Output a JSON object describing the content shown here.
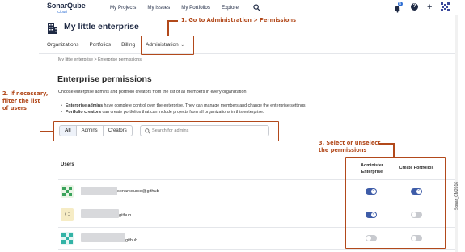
{
  "topnav": {
    "logo_name": "SonarQube",
    "logo_sub": "Cloud",
    "links": [
      "My Projects",
      "My Issues",
      "My Portfolios",
      "Explore"
    ],
    "notification_count": "5",
    "help_label": "?",
    "plus_label": "+"
  },
  "org": {
    "title": "My little enterprise",
    "tabs": [
      "Organizations",
      "Portfolios",
      "Billing",
      "Administration"
    ]
  },
  "breadcrumb": "My little enterprise > Enterprise permissions",
  "page": {
    "title": "Enterprise permissions",
    "intro": "Choose enterprise admins and portfolio creators from the list of all members in every organization.",
    "bullets": [
      {
        "bold": "Enterprise admins",
        "text": " have complete control over the enterprise. They can manage members and change the enterprise settings."
      },
      {
        "bold": "Portfolio creators",
        "text": " can create portfolios that can include projects from all organizations in this enterprise."
      }
    ]
  },
  "filters": {
    "buttons": [
      "All",
      "Admins",
      "Creators"
    ],
    "active": "All",
    "search_placeholder": "Search for admins"
  },
  "table": {
    "col_users": "Users",
    "col_admin_line1": "Administer",
    "col_admin_line2": "Enterprise",
    "col_create": "Create Portfolios",
    "rows": [
      {
        "avatar_letter": "",
        "suffix": "sonarsource@github",
        "administer": true,
        "create": true
      },
      {
        "avatar_letter": "C",
        "suffix": "github",
        "administer": true,
        "create": false
      },
      {
        "avatar_letter": "",
        "suffix": "github",
        "administer": false,
        "create": false
      }
    ]
  },
  "annotations": {
    "step1": "1. Go to Administration > Permissions",
    "step2": [
      "2. If necessary,",
      "filter the list",
      "of users"
    ],
    "step3": [
      "3. Select or unselect",
      "the permissions"
    ],
    "watermark": "Sonar_CM2016",
    "color": "#b2491b"
  },
  "colors": {
    "toggle_on": "#3e5ca8",
    "toggle_off": "#c8cacf",
    "brand": "#2f6fd4"
  }
}
